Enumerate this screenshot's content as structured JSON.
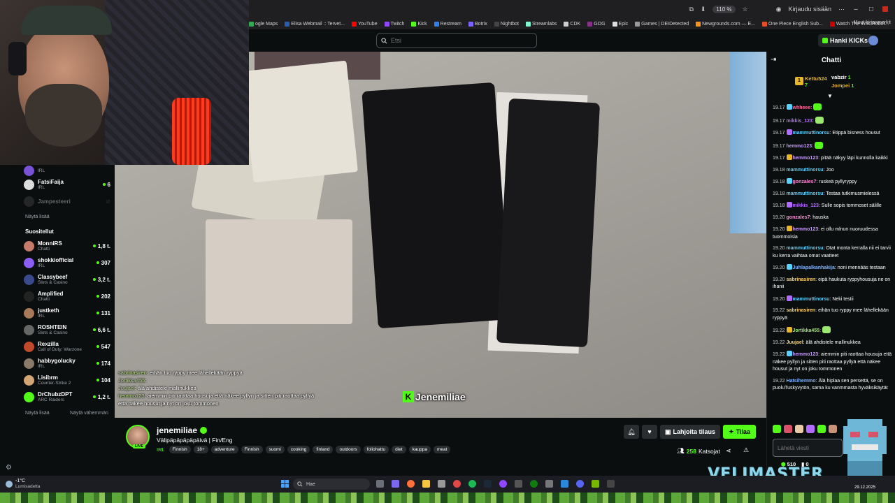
{
  "browser": {
    "zoom": "110 %",
    "sign_in": "Kirjaudu sisään",
    "bookmarks": [
      {
        "label": "ogle Maps",
        "color": "#34a853"
      },
      {
        "label": "Elisa Webmail :: Tervet...",
        "color": "#2b5cad"
      },
      {
        "label": "YouTube",
        "color": "#ff0000"
      },
      {
        "label": "Twitch",
        "color": "#9146ff"
      },
      {
        "label": "Kick",
        "color": "#53fc18"
      },
      {
        "label": "Restream",
        "color": "#2f80ed"
      },
      {
        "label": "Botrix",
        "color": "#7b61ff"
      },
      {
        "label": "Nightbot",
        "color": "#444444"
      },
      {
        "label": "Streamlabs",
        "color": "#80f5d2"
      },
      {
        "label": "CDK",
        "color": "#cccccc"
      },
      {
        "label": "GOG",
        "color": "#86328a"
      },
      {
        "label": "Epic",
        "color": "#dddddd"
      },
      {
        "label": "Games | DEIDetected",
        "color": "#999999"
      },
      {
        "label": "Newgrounds.com — E...",
        "color": "#f7941d"
      },
      {
        "label": "One Piece English Sub...",
        "color": "#e44d26"
      },
      {
        "label": "Watch The Wild Robot...",
        "color": "#cc0000"
      },
      {
        "label": "Aikuisten sosiaalipalve...",
        "color": "#d93025"
      }
    ],
    "bookmarks_more": "Muut kirjanmerkit"
  },
  "header": {
    "search_placeholder": "Etsi",
    "get_kicks": "Hanki KICKs"
  },
  "sidebar": {
    "followed": [
      {
        "name": "FatsiFaija",
        "category": "IRL",
        "viewers": "6",
        "color": "#ddd"
      },
      {
        "name": "Jampesteeri",
        "category": "",
        "viewers": "",
        "color": "#555"
      }
    ],
    "top_partial": {
      "category": "IRL"
    },
    "show_more": "Näytä lisää",
    "recommended_heading": "Suositellut",
    "recommended": [
      {
        "name": "MonniRS",
        "category": "Chatti",
        "viewers": "1,8 t.",
        "color": "#c77b6a"
      },
      {
        "name": "shokkiofficial",
        "category": "IRL",
        "viewers": "307",
        "color": "#8b5cf6"
      },
      {
        "name": "Classybeef",
        "category": "Slots & Casino",
        "viewers": "3,2 t.",
        "color": "#3b4a8a"
      },
      {
        "name": "Amplified",
        "category": "Chatti",
        "viewers": "202",
        "color": "#222"
      },
      {
        "name": "justketh",
        "category": "IRL",
        "viewers": "131",
        "color": "#a97a5a"
      },
      {
        "name": "ROSHTEIN",
        "category": "Slots & Casino",
        "viewers": "6,6 t.",
        "color": "#666"
      },
      {
        "name": "Rexzilla",
        "category": "Call of Duty: Warzone",
        "viewers": "547",
        "color": "#c04a2a"
      },
      {
        "name": "habbygolucky",
        "category": "IRL",
        "viewers": "174",
        "color": "#8a7a6a"
      },
      {
        "name": "Lisibrm",
        "category": "Counter-Strike 2",
        "viewers": "104",
        "color": "#d4a574"
      },
      {
        "name": "DrChubzDPT",
        "category": "ARC Raiders",
        "viewers": "1,2 t.",
        "color": "#53fc18"
      }
    ],
    "show_more_2": "Näytä lisää",
    "show_less": "Näytä vähemmän"
  },
  "video": {
    "overlay_chat": [
      {
        "user": "sabrinasiren",
        "text": ": eihän tuo ryppy mee lähellekään ryppyä"
      },
      {
        "user": "Jortikka455",
        "text": ":"
      },
      {
        "user": "Juujael",
        "text": ": älä ahdistele mallinukkea"
      },
      {
        "user": "hemmo123",
        "text": ": aiemmin piti raottaa housuja että näkee pyllyn ja sitten piti raottaa pyllyä"
      },
      {
        "user": "",
        "text": "että näkee housut      ja nyt on joku tommonen"
      }
    ],
    "overlay_name": "Jenemiliae"
  },
  "stream": {
    "streamer": "jenemiliae",
    "live_label": "LIVE",
    "title": "Välipäpäpäpäpäivä | Fin/Eng",
    "category": "IRL",
    "tags": [
      "Finnish",
      "18+",
      "adventure",
      "Finnish",
      "suomi",
      "cooking",
      "finland",
      "outdoors",
      "foliohattu",
      "diet",
      "kauppa",
      "meat"
    ],
    "gift_label": "Lahjoita tilaus",
    "subscribe_label": "Tilaa",
    "viewer_count": "258",
    "viewer_label": "Katsojat"
  },
  "chat": {
    "title": "Chatti",
    "leaderboard": [
      {
        "name": "Kettu524",
        "count": "7",
        "color": "#e8b62a"
      },
      {
        "name": "vabzir",
        "count": "1",
        "color": "#ffffff"
      },
      {
        "name": "Jompei",
        "count": "1",
        "color": "#e8b62a"
      }
    ],
    "messages": [
      {
        "time": "19.17",
        "user": "whheee",
        "color": "#ff6b9d",
        "text": ""
      },
      {
        "time": "19.17",
        "user": "mikkis_123",
        "color": "#b46bff",
        "text": ""
      },
      {
        "time": "19.17",
        "user": "mammuttinorsu",
        "color": "#5ad2ff",
        "text": "Etippä bisness housut"
      },
      {
        "time": "19.17",
        "user": "hemmo123",
        "color": "#c89bff",
        "text": ""
      },
      {
        "time": "19.17",
        "user": "hemmo123",
        "color": "#c89bff",
        "text": "pitää näkyy läpi kunnolla kaikki"
      },
      {
        "time": "19.18",
        "user": "mammuttinorsu",
        "color": "#5ad2ff",
        "text": "Joo"
      },
      {
        "time": "19.18",
        "user": "gonzales7",
        "color": "#ff8ad8",
        "text": "ruskeä pyllyryppy"
      },
      {
        "time": "19.18",
        "user": "mammuttinorsu",
        "color": "#5ad2ff",
        "text": "Testaa tutkimusmielessä"
      },
      {
        "time": "19.18",
        "user": "mikkis_123",
        "color": "#b46bff",
        "text": "Sulle sopis tommoset sälille"
      },
      {
        "time": "19.20",
        "user": "gonzales7",
        "color": "#ff8ad8",
        "text": "hauska"
      },
      {
        "time": "19.20",
        "user": "hemmo123",
        "color": "#c89bff",
        "text": "ei ollu mlnun nuoruudessa tuommoisia"
      },
      {
        "time": "19.20",
        "user": "mammuttinorsu",
        "color": "#5ad2ff",
        "text": "Otat monta kerralla nii ei tarvii ku kerra vaihtaa omat vaatteet"
      },
      {
        "time": "19.20",
        "user": "Juhlapalkanhakija",
        "color": "#7fb4ff",
        "text": "noni mennääs testaan"
      },
      {
        "time": "19.20",
        "user": "sabrinasiren",
        "color": "#ffd36b",
        "text": "eipä haukuta ryppyhousuja ne on ihanii"
      },
      {
        "time": "19.20",
        "user": "mammuttinorsu",
        "color": "#5ad2ff",
        "text": "Neki testii"
      },
      {
        "time": "19.22",
        "user": "sabrinasiren",
        "color": "#ffd36b",
        "text": "eihän tuo ryppy mee lähellekään ryppyä"
      },
      {
        "time": "19.22",
        "user": "Jortikka455",
        "color": "#9be870",
        "text": ""
      },
      {
        "time": "19.22",
        "user": "Juujael",
        "color": "#ffd36b",
        "text": "älä ahdistele mallinukkea"
      },
      {
        "time": "19.22",
        "user": "hemmo123",
        "color": "#c89bff",
        "text": "aiemmin piti raottaa housuja että näkee pyllyn ja sitten piti raottaa pyllyä että näkee housut     ja nyt on joku tommonen"
      },
      {
        "time": "19.22",
        "user": "Hatsihemmo",
        "color": "#7fb4ff",
        "text": "Älä hiplaa sen persettä, se on puoluTuskyvytön, sama ku vanmmasta hyväksikäytät"
      }
    ],
    "input_placeholder": "Lähetä viesti",
    "stat_points": "510",
    "stat_other": "0"
  },
  "overlay": {
    "brand": "VELIMASTER"
  },
  "taskbar": {
    "temp": "-1°C",
    "weather": "Lumisadetta",
    "search_placeholder": "Hae",
    "date": "29.12.2025"
  }
}
